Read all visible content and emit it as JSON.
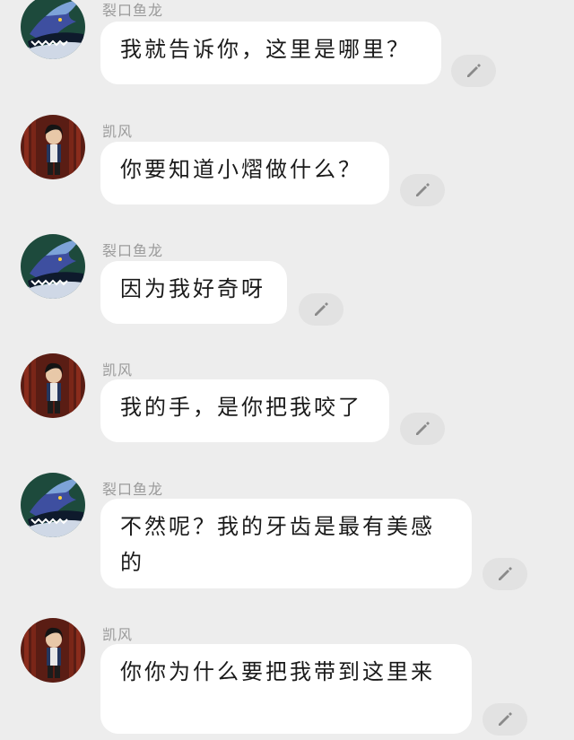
{
  "messages": [
    {
      "sender": "裂口鱼龙",
      "avatar": "dragon-avatar",
      "text": "我就告诉你，这里是哪里？"
    },
    {
      "sender": "凯风",
      "avatar": "boy-avatar",
      "text": "你要知道小熠做什么？"
    },
    {
      "sender": "裂口鱼龙",
      "avatar": "dragon-avatar",
      "text": "因为我好奇呀"
    },
    {
      "sender": "凯风",
      "avatar": "boy-avatar",
      "text": "我的手，是你把我咬了"
    },
    {
      "sender": "裂口鱼龙",
      "avatar": "dragon-avatar",
      "text": "不然呢？我的牙齿是最有美感的"
    },
    {
      "sender": "凯风",
      "avatar": "boy-avatar",
      "text": "你你为什么要把我带到这里来"
    }
  ],
  "icons": {
    "edit": "pencil-icon"
  },
  "colors": {
    "background": "#ededed",
    "bubble": "#ffffff",
    "edit_button": "#e2e2e2",
    "sender_name": "#9a9a9a"
  }
}
